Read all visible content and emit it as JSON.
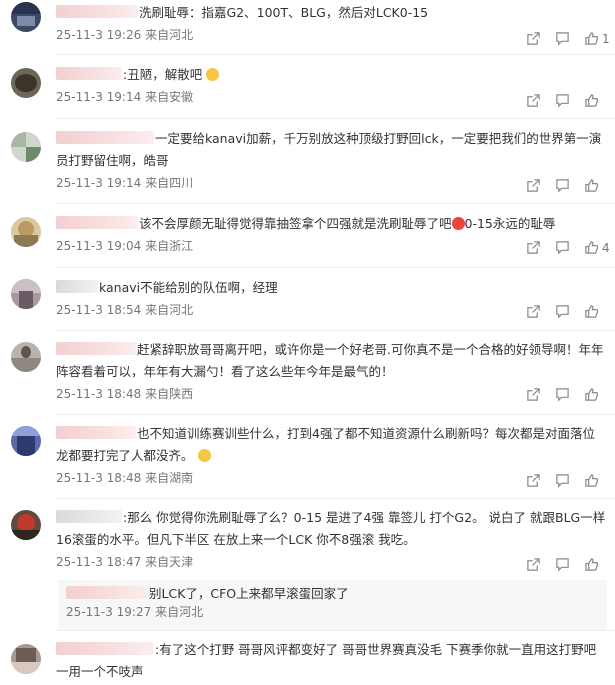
{
  "comments": [
    {
      "text": "洗刷耻辱：指嘉G2、100T、BLG，然后对LCK0-15",
      "date": "25-11-3 19:26",
      "location": "来自河北",
      "likes": "1"
    },
    {
      "text": ":丑陋，解散吧",
      "date": "25-11-3 19:14",
      "location": "来自安徽",
      "likes": ""
    },
    {
      "text": "一定要给kanavi加薪，千万别放这种顶级打野回lck，一定要把我们的世界第一演员打野留住啊，皓哥",
      "date": "25-11-3 19:14",
      "location": "来自四川",
      "likes": ""
    },
    {
      "text": "该不会厚颜无耻得觉得靠抽签拿个四强就是洗刷耻辱了吧",
      "text_tail": "0-15永远的耻辱",
      "date": "25-11-3 19:04",
      "location": "来自浙江",
      "likes": "4"
    },
    {
      "text": "kanavi不能给别的队伍啊，经理",
      "date": "25-11-3 18:54",
      "location": "来自河北",
      "likes": ""
    },
    {
      "text": "赶紧辞职放哥哥离开吧，或许你是一个好老哥.可你真不是一个合格的好领导啊！年年阵容看着可以，年年有大漏勺！看了这么些年今年是最气的！",
      "date": "25-11-3 18:48",
      "location": "来自陕西",
      "likes": ""
    },
    {
      "text": "也不知道训练赛训些什么，打到4强了都不知道资源什么刷新吗？每次都是对面落位龙都要打完了人都没齐。",
      "date": "25-11-3 18:48",
      "location": "来自湖南",
      "likes": ""
    },
    {
      "text": ":那么 你觉得你洗刷耻辱了么？0-15 是进了4强 靠签儿 打个G2。 说白了 就跟BLG一样16滚蛋的水平。但凡下半区 在放上来一个LCK 你不8强滚 我吃。",
      "date": "25-11-3 18:47",
      "location": "来自天津",
      "likes": ""
    },
    {
      "text": ":有了这个打野 哥哥风评都变好了 哥哥世界赛真没毛 下赛季你就一直用这打野吧 一用一个不吱声",
      "date": "",
      "location": "",
      "likes": ""
    }
  ],
  "reply": {
    "text": "别LCK了，CFO上来都早滚蛋回家了",
    "date": "25-11-3 19:27",
    "location": "来自河北"
  },
  "icons": {
    "share": "share-icon",
    "comment": "comment-icon",
    "like": "thumbs-up-icon"
  }
}
